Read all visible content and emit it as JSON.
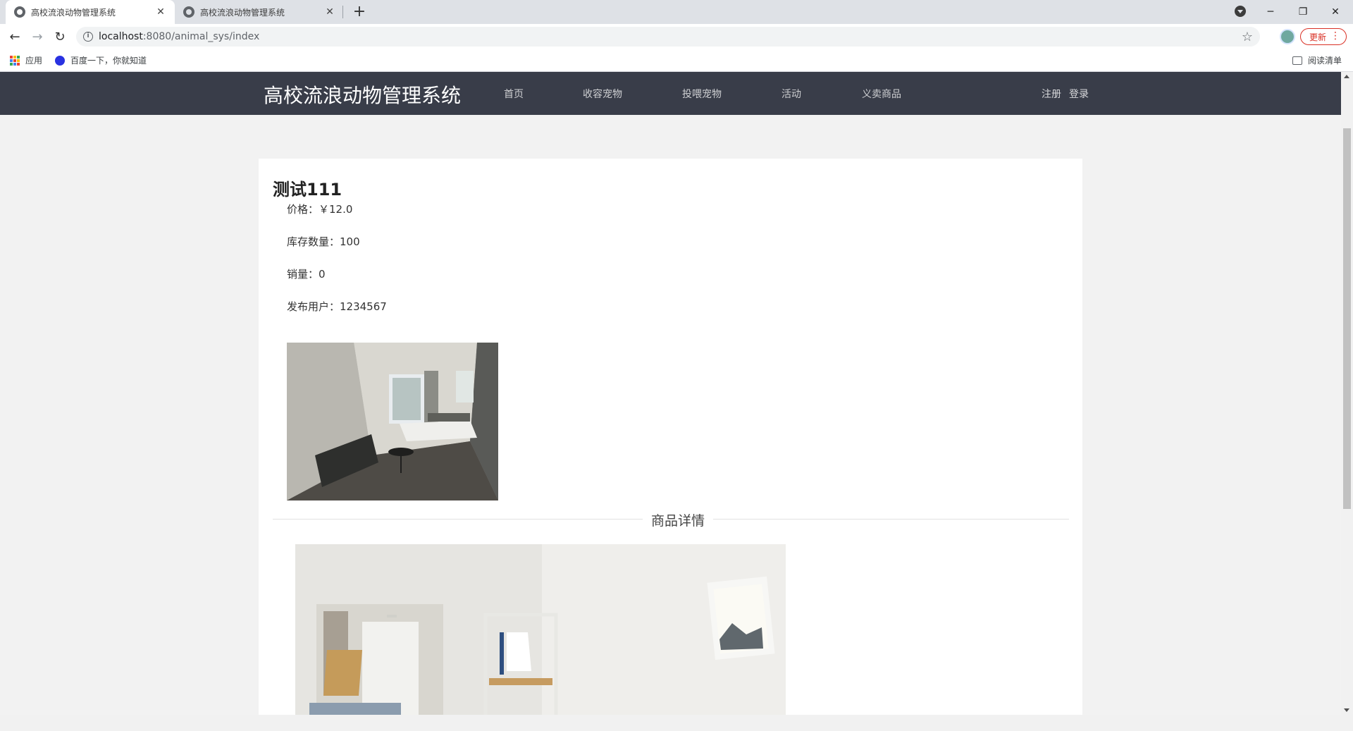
{
  "browser": {
    "tabs": [
      {
        "title": "高校流浪动物管理系统",
        "active": true
      },
      {
        "title": "高校流浪动物管理系统",
        "active": false
      }
    ],
    "url_host": "localhost",
    "url_path": ":8080/animal_sys/index",
    "update_label": "更新",
    "bookmarks": {
      "apps": "应用",
      "baidu": "百度一下，你就知道",
      "reading_list": "阅读清单"
    }
  },
  "site": {
    "brand": "高校流浪动物管理系统",
    "nav": [
      "首页",
      "收容宠物",
      "投喂宠物",
      "活动",
      "义卖商品"
    ],
    "register": "注册",
    "login": "登录"
  },
  "product": {
    "title": "测试111",
    "price": "价格：￥12.0",
    "stock": "库存数量：100",
    "sales": "销量：0",
    "publisher": "发布用户：1234567",
    "details_heading": "商品详情"
  }
}
